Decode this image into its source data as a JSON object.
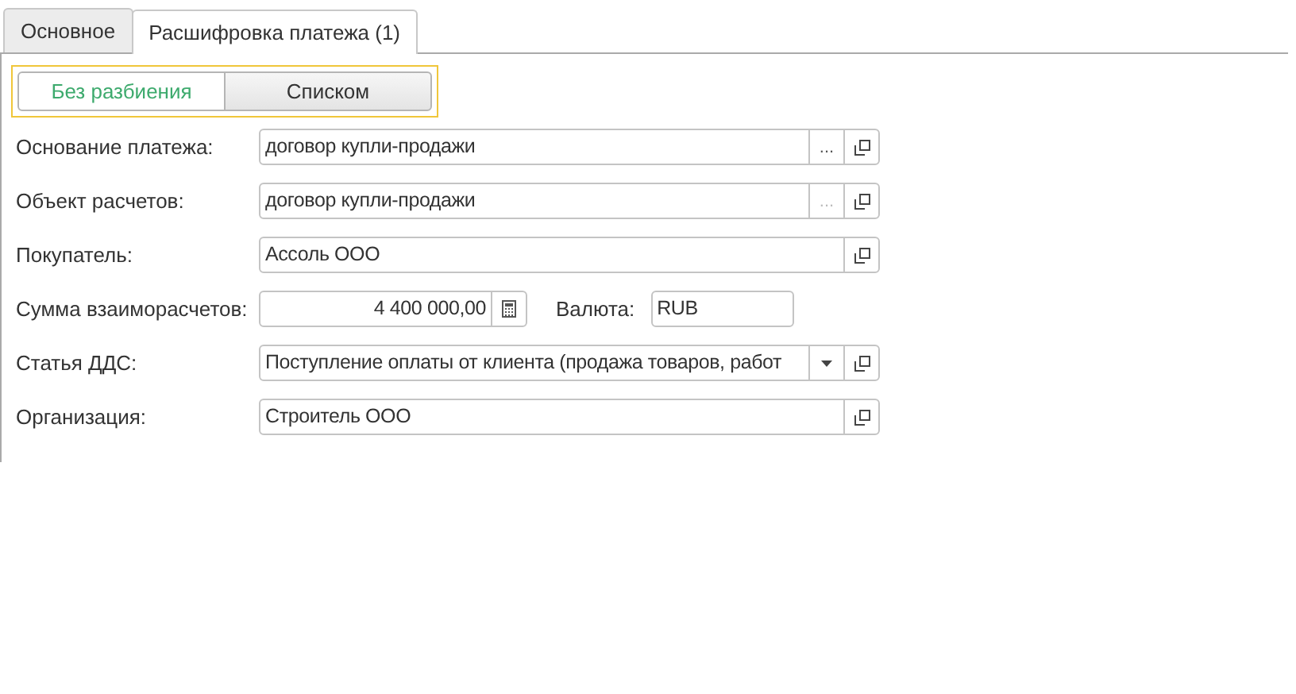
{
  "tabs": [
    {
      "label": "Основное",
      "selected": false
    },
    {
      "label": "Расшифровка платежа (1)",
      "selected": true
    }
  ],
  "mode_switch": [
    {
      "label": "Без разбиения",
      "selected": true
    },
    {
      "label": "Списком",
      "selected": false
    }
  ],
  "fields": [
    {
      "kind": "reference",
      "label": "Основание платежа:",
      "value": "договор купли-продажи",
      "choice_button": "...",
      "choice_enabled": true
    },
    {
      "kind": "reference",
      "label": "Объект расчетов:",
      "value": "договор купли-продажи",
      "choice_button": "...",
      "choice_enabled": false
    },
    {
      "kind": "reference",
      "label": "Покупатель:",
      "value": "Ассоль ООО"
    },
    {
      "kind": "amount",
      "label": "Сумма взаиморасчетов:",
      "value": "4 400 000,00",
      "currency_label": "Валюта:",
      "currency": "RUB"
    },
    {
      "kind": "dropdown",
      "label": "Статья ДДС:",
      "value": "Поступление оплаты от клиента (продажа товаров, работ"
    },
    {
      "kind": "reference",
      "label": "Организация:",
      "value": "Строитель ООО"
    }
  ]
}
